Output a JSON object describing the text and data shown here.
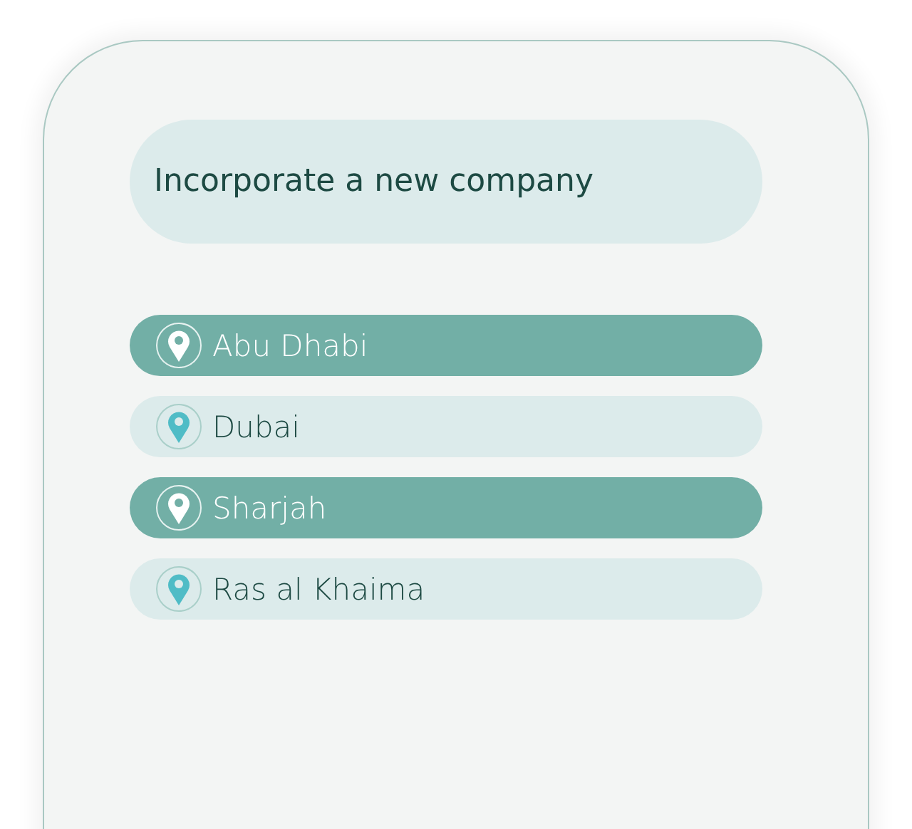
{
  "header": {
    "title": "Incorporate a new company"
  },
  "locations": [
    {
      "label": "Abu Dhabi",
      "selected": true
    },
    {
      "label": "Dubai",
      "selected": false
    },
    {
      "label": "Sharjah",
      "selected": true
    },
    {
      "label": "Ras al Khaima",
      "selected": false
    }
  ]
}
